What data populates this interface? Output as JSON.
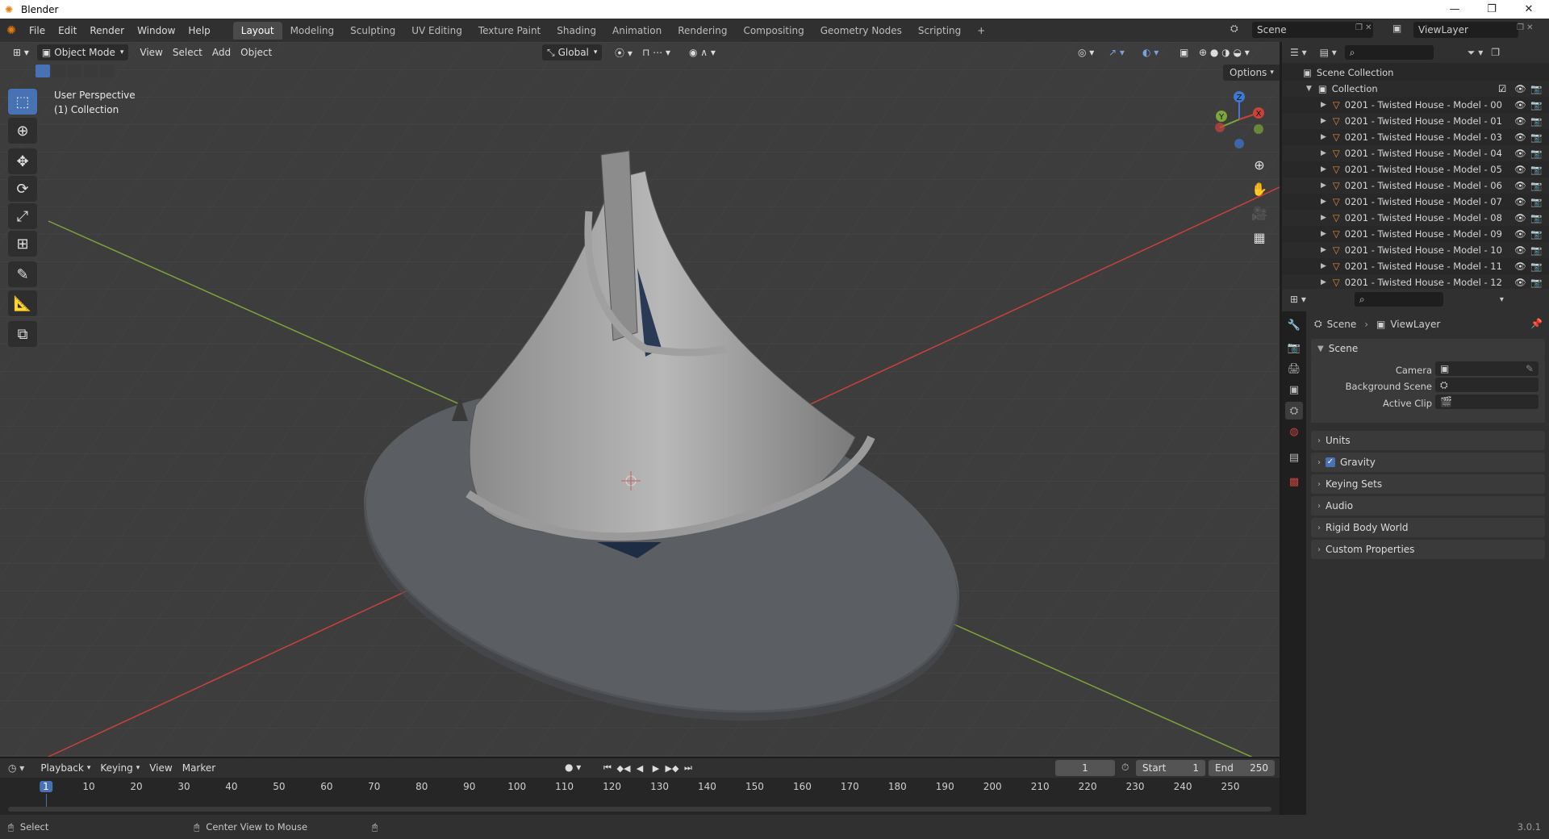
{
  "window": {
    "title": "Blender"
  },
  "menu": [
    "File",
    "Edit",
    "Render",
    "Window",
    "Help"
  ],
  "workspaces": [
    "Layout",
    "Modeling",
    "Sculpting",
    "UV Editing",
    "Texture Paint",
    "Shading",
    "Animation",
    "Rendering",
    "Compositing",
    "Geometry Nodes",
    "Scripting"
  ],
  "active_workspace": "Layout",
  "scene_field": "Scene",
  "viewlayer_field": "ViewLayer",
  "viewport": {
    "mode": "Object Mode",
    "menus": [
      "View",
      "Select",
      "Add",
      "Object"
    ],
    "orientation": "Global",
    "options_label": "Options",
    "overlay_line1": "User Perspective",
    "overlay_line2": "(1) Collection",
    "gizmo": {
      "x": "X",
      "y": "Y",
      "z": "Z"
    }
  },
  "outliner": {
    "root": "Scene Collection",
    "collection": "Collection",
    "objects": [
      "0201 - Twisted House - Model - 00",
      "0201 - Twisted House - Model - 01",
      "0201 - Twisted House - Model - 03",
      "0201 - Twisted House - Model - 04",
      "0201 - Twisted House - Model - 05",
      "0201 - Twisted House - Model - 06",
      "0201 - Twisted House - Model - 07",
      "0201 - Twisted House - Model - 08",
      "0201 - Twisted House - Model - 09",
      "0201 - Twisted House - Model - 10",
      "0201 - Twisted House - Model - 11",
      "0201 - Twisted House - Model - 12"
    ]
  },
  "properties": {
    "breadcrumb_scene": "Scene",
    "breadcrumb_viewlayer": "ViewLayer",
    "panel_scene": "Scene",
    "camera_label": "Camera",
    "background_scene_label": "Background Scene",
    "active_clip_label": "Active Clip",
    "panels": [
      "Units",
      "Gravity",
      "Keying Sets",
      "Audio",
      "Rigid Body World",
      "Custom Properties"
    ]
  },
  "timeline": {
    "menus": [
      "Playback",
      "Keying",
      "View",
      "Marker"
    ],
    "current_frame": "1",
    "start_label": "Start",
    "start_value": "1",
    "end_label": "End",
    "end_value": "250",
    "ticks": [
      "1",
      "10",
      "20",
      "30",
      "40",
      "50",
      "60",
      "70",
      "80",
      "90",
      "100",
      "110",
      "120",
      "130",
      "140",
      "150",
      "160",
      "170",
      "180",
      "190",
      "200",
      "210",
      "220",
      "230",
      "240",
      "250"
    ]
  },
  "statusbar": {
    "select": "Select",
    "center_view": "Center View to Mouse",
    "version": "3.0.1"
  },
  "colors": {
    "accent": "#4772b3",
    "x_axis": "#c8423c",
    "y_axis": "#7da53a",
    "z_axis": "#3e78d4",
    "object_icon": "#e38a3c"
  }
}
